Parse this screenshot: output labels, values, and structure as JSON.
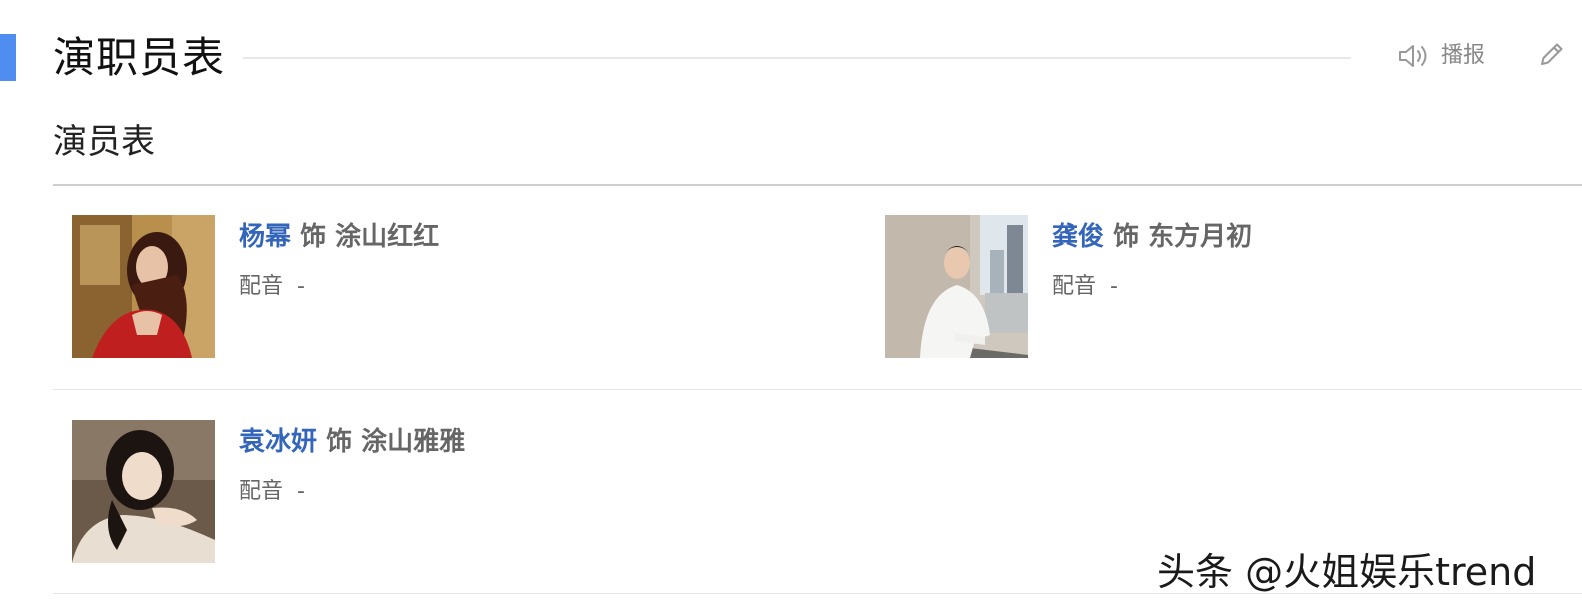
{
  "section": {
    "title": "演职员表",
    "broadcast_label": "播报",
    "speak_icon": "speaker-icon",
    "edit_icon": "pencil-icon"
  },
  "cast_list": {
    "title": "演员表",
    "items": [
      {
        "actor": "杨幂",
        "as_word": "饰",
        "role": "涂山红红",
        "voice_label": "配音",
        "voice_value": "-"
      },
      {
        "actor": "龚俊",
        "as_word": "饰",
        "role": "东方月初",
        "voice_label": "配音",
        "voice_value": "-"
      },
      {
        "actor": "袁冰妍",
        "as_word": "饰",
        "role": "涂山雅雅",
        "voice_label": "配音",
        "voice_value": "-"
      }
    ]
  },
  "watermark": "头条 @火姐娱乐trend",
  "colors": {
    "accent": "#4f8ef0",
    "link": "#3366bb",
    "muted": "#666666"
  }
}
